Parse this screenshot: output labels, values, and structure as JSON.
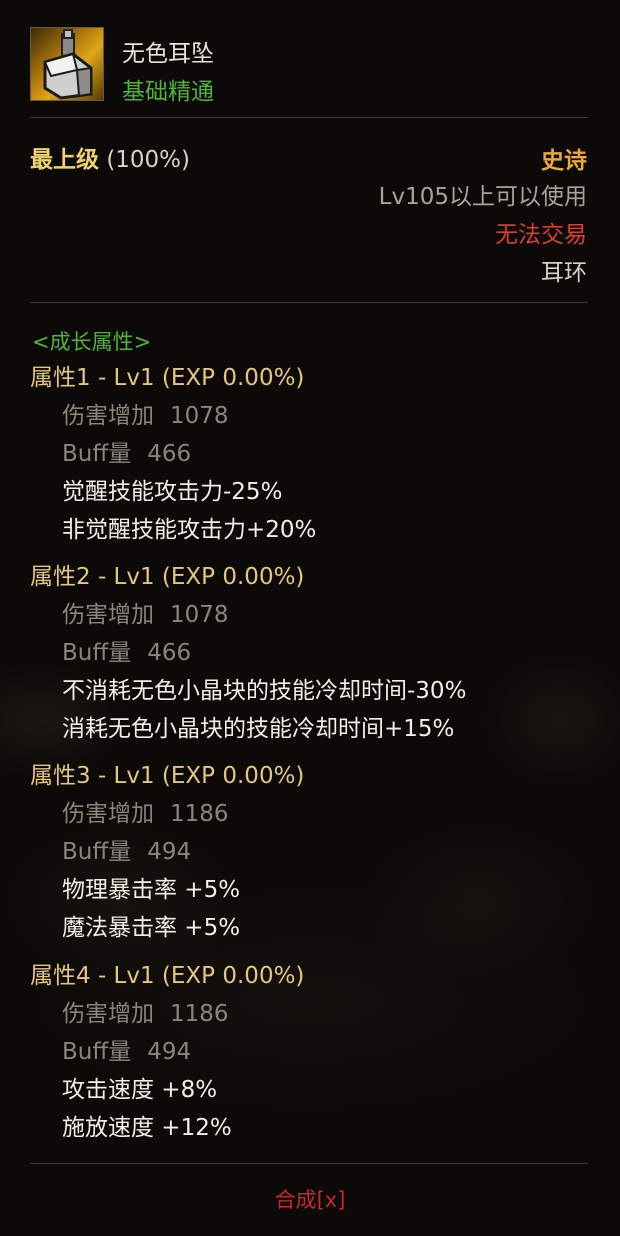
{
  "item": {
    "name": "无色耳坠",
    "subtitle": "基础精通",
    "icon": "earring-icon"
  },
  "grade": {
    "label": "最上级",
    "value": "(100%)"
  },
  "info": {
    "rarity": "史诗",
    "level_req": "Lv105以上可以使用",
    "trade": "无法交易",
    "slot": "耳环"
  },
  "growth_header": "<成长属性>",
  "attributes": [
    {
      "title": "属性1 - Lv1 (EXP 0.00%)",
      "damage_label": "伤害增加",
      "damage_value": "1078",
      "buff_label": "Buff量",
      "buff_value": "466",
      "effects": [
        "觉醒技能攻击力-25%",
        "非觉醒技能攻击力+20%"
      ]
    },
    {
      "title": "属性2 - Lv1 (EXP 0.00%)",
      "damage_label": "伤害增加",
      "damage_value": "1078",
      "buff_label": "Buff量",
      "buff_value": "466",
      "effects": [
        "不消耗无色小晶块的技能冷却时间-30%",
        "消耗无色小晶块的技能冷却时间+15%"
      ]
    },
    {
      "title": "属性3 - Lv1 (EXP 0.00%)",
      "damage_label": "伤害增加",
      "damage_value": "1186",
      "buff_label": "Buff量",
      "buff_value": "494",
      "effects": [
        "物理暴击率 +5%",
        "魔法暴击率 +5%"
      ]
    },
    {
      "title": "属性4 - Lv1 (EXP 0.00%)",
      "damage_label": "伤害增加",
      "damage_value": "1186",
      "buff_label": "Buff量",
      "buff_value": "494",
      "effects": [
        "攻击速度 +8%",
        "施放速度 +12%"
      ]
    }
  ],
  "footer": {
    "synthesis": "合成[x]"
  },
  "colors": {
    "rarity_epic": "#e8a83a",
    "untradeable": "#d8402c",
    "growth_green": "#52b33a",
    "attr_title_gold": "#e6c67a"
  }
}
